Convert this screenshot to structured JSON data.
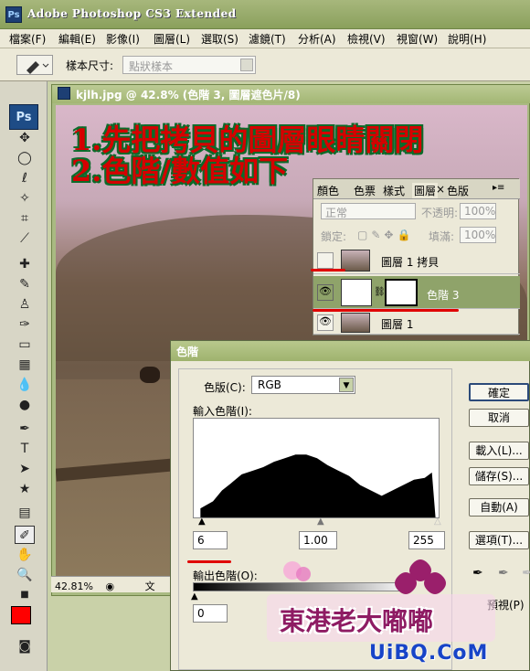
{
  "app": {
    "title": "Adobe Photoshop CS3 Extended",
    "logo": "Ps"
  },
  "menu": [
    "檔案(F)",
    "編輯(E)",
    "影像(I)",
    "圖層(L)",
    "選取(S)",
    "濾鏡(T)",
    "分析(A)",
    "檢視(V)",
    "視窗(W)",
    "說明(H)"
  ],
  "options": {
    "sample_label": "樣本尺寸:",
    "sample_value": "點狀樣本"
  },
  "document": {
    "title": "kjlh.jpg @ 42.8% (色階 3, 圖層遮色片/8)",
    "zoom": "42.81%",
    "status_tail": "文"
  },
  "annotation": {
    "line1": "1.先把拷貝的圖層眼睛關閉",
    "line2": "2.色階/數值如下"
  },
  "layers_panel": {
    "tabs": [
      "顏色",
      "色票",
      "樣式",
      "圖層",
      "色版"
    ],
    "blend_mode": "正常",
    "opacity_label": "不透明:",
    "opacity_value": "100%",
    "lock_label": "鎖定:",
    "fill_label": "填滿:",
    "fill_value": "100%",
    "layers": [
      {
        "name": "圖層 1 拷貝",
        "visible": false
      },
      {
        "name": "色階 3",
        "visible": true,
        "selected": true
      },
      {
        "name": "圖層 1",
        "visible": true
      }
    ]
  },
  "levels_dialog": {
    "title": "色階",
    "channel_label": "色版(C):",
    "channel_value": "RGB",
    "input_label": "輸入色階(I):",
    "input_black": "6",
    "input_gamma": "1.00",
    "input_white": "255",
    "output_label": "輸出色階(O):",
    "output_black": "0",
    "buttons": {
      "ok": "確定",
      "cancel": "取消",
      "load": "載入(L)...",
      "save": "儲存(S)...",
      "auto": "自動(A)",
      "options": "選項(T)..."
    },
    "preview_label": "預視(P)"
  },
  "watermark": {
    "title": "東港老大嘟嘟",
    "url": "UiBQ.CoM"
  },
  "colors": {
    "foreground": "#ff0000",
    "background": "#ffffff",
    "annotation_red": "#d50000"
  }
}
